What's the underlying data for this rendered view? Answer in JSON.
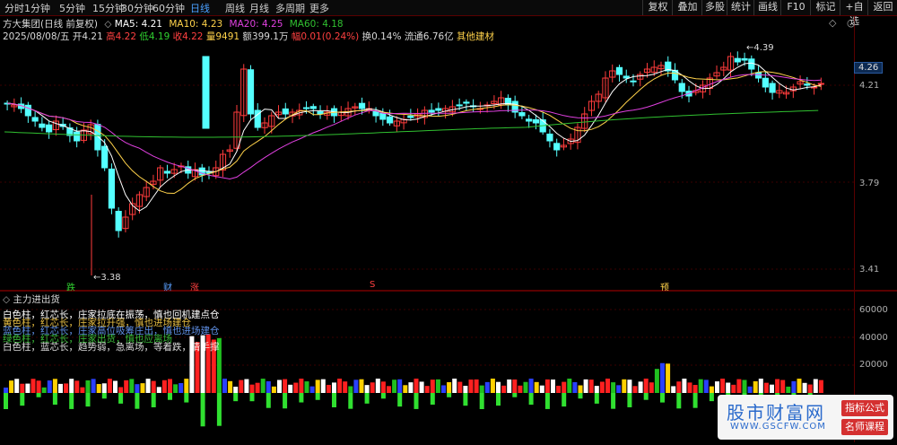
{
  "toolbar": {
    "left_items": [
      "分时",
      "1分钟",
      "5分钟",
      "15分钟",
      "30分钟",
      "60分钟",
      "日线",
      "周线",
      "月线",
      "多周期",
      "更多"
    ],
    "active_index": 6,
    "right_items": [
      "复权",
      "叠加",
      "多股",
      "统计",
      "画线",
      "F10",
      "标记",
      "+自选",
      "返回"
    ]
  },
  "header": {
    "title": "方大集团(日线 前复权)",
    "ma5": "MA5: 4.21",
    "ma10": "MA10: 4.23",
    "ma20": "MA20: 4.25",
    "ma60": "MA60: 4.18",
    "date": "2025/08/08/五",
    "open": "开4.21",
    "high": "高4.22",
    "low": "低4.19",
    "close": "收4.22",
    "vol": "量9491",
    "amount": "额399.1万",
    "change": "幅0.01(0.24%)",
    "turnover": "换0.14%",
    "float": "流通6.76亿",
    "sector": "其他建材"
  },
  "price_axis": [
    "4.21",
    "3.79",
    "3.41"
  ],
  "current_price_tag": "4.26",
  "annotations": {
    "high_mark": "4.39",
    "low_mark": "3.38",
    "events": [
      "跌",
      "财",
      "涨",
      "S",
      "预"
    ]
  },
  "subchart": {
    "title": "主力进出货",
    "legend": [
      "白色柱，红芯长，庄家拉底在振荡，慎也回机建点仓",
      "黄色柱，红芯长，庄家拉升强，慎也进场建仓",
      "蓝色柱，红芯长，庄家高位吸筹庄出，慎也进场建仓",
      "绿色柱，红芯长，庄家出货，慎也应离场",
      "白色柱，蓝芯长，趋势弱，急离场，等着跌，清手撑"
    ],
    "axis": [
      "60000",
      "40000",
      "20000"
    ]
  },
  "watermark": {
    "name": "股市财富网",
    "url": "WWW.GSCFW.COM",
    "tag1": "指标公式",
    "tag2": "名师课程"
  },
  "colors": {
    "up": "#ff3c3c",
    "down": "#54ffff",
    "ma5": "#ffffff",
    "ma10": "#ffd24a",
    "ma20": "#e040e0",
    "ma60": "#30c030"
  }
}
